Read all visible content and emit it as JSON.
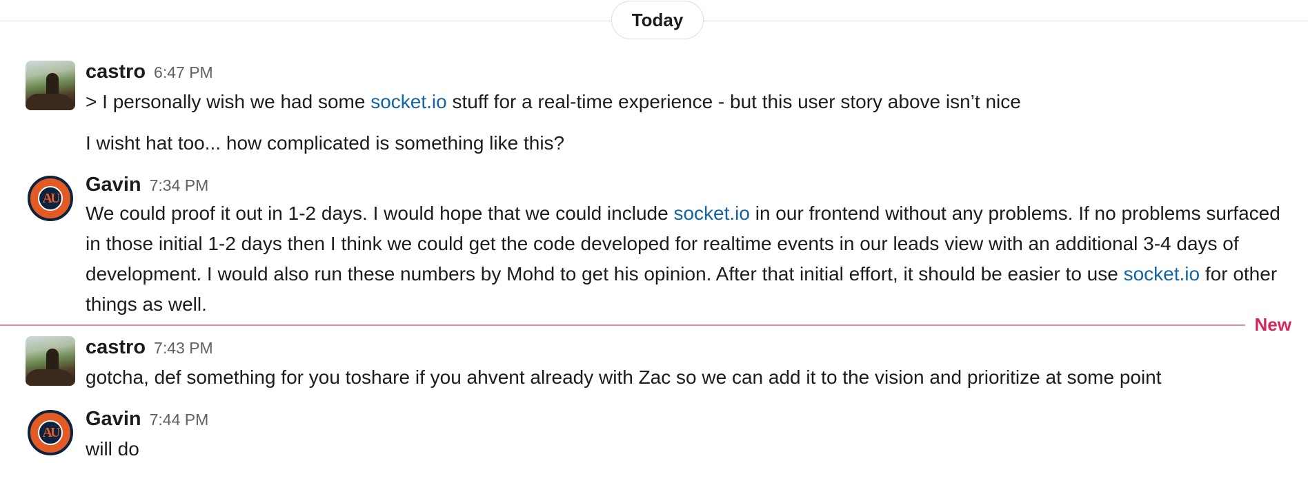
{
  "divider": {
    "label": "Today"
  },
  "new_divider": {
    "label": "New"
  },
  "messages": [
    {
      "sender": "castro",
      "time": "6:47 PM",
      "avatar_icon": "landscape-photo-avatar",
      "lines": [
        {
          "before": "> I personally wish we had some ",
          "link": "socket.io",
          "after": " stuff for a real-time experience - but this user story above isn’t nice"
        },
        {
          "text": "I wisht hat too... how complicated is something like this?"
        }
      ]
    },
    {
      "sender": "Gavin",
      "time": "7:34 PM",
      "avatar_icon": "auburn-tigers-logo-avatar",
      "avatar_monogram": "AU",
      "body": {
        "part1": "We could proof it out in 1-2 days.  I would hope that we could include ",
        "link1": "socket.io",
        "part2": " in our frontend without any problems.  If no problems surfaced in those initial 1-2 days then I think we could get the code developed for realtime events in our leads view with an additional 3-4 days of development.  I would also run these numbers by Mohd to get his opinion.  After that initial effort, it should be easier to use ",
        "link2": "socket.io",
        "part3": " for other things as well."
      }
    },
    {
      "sender": "castro",
      "time": "7:43 PM",
      "avatar_icon": "landscape-photo-avatar",
      "text": "gotcha, def something for you toshare if you ahvent already with Zac so we can add it to the vision and prioritize at some point"
    },
    {
      "sender": "Gavin",
      "time": "7:44 PM",
      "avatar_icon": "auburn-tigers-logo-avatar",
      "avatar_monogram": "AU",
      "text": "will do"
    }
  ],
  "colors": {
    "link": "#1264a3",
    "new_divider": "#e01e5a",
    "text": "#1d1c1d",
    "timestamp": "#616061"
  }
}
